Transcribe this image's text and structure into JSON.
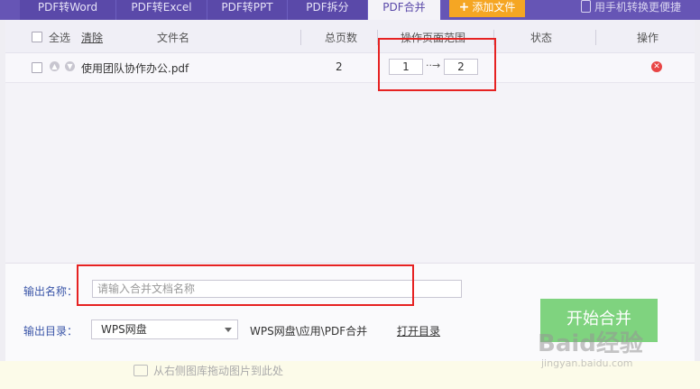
{
  "tabs": [
    {
      "label": "PDF转Word",
      "active": false
    },
    {
      "label": "PDF转Excel",
      "active": false
    },
    {
      "label": "PDF转PPT",
      "active": false
    },
    {
      "label": "PDF拆分",
      "active": false
    },
    {
      "label": "PDF合并",
      "active": true
    }
  ],
  "toolbar": {
    "add_file_label": "添加文件",
    "phone_hint": "用手机转换更便捷"
  },
  "table": {
    "headers": {
      "select_all": "全选",
      "clear": "清除",
      "filename": "文件名",
      "total_pages": "总页数",
      "page_range": "操作页面范围",
      "status": "状态",
      "actions": "操作"
    },
    "rows": [
      {
        "filename": "使用团队协作办公.pdf",
        "total_pages": "2",
        "range_from": "1",
        "range_to": "2",
        "status": ""
      }
    ]
  },
  "output": {
    "name_label": "输出名称：",
    "name_placeholder": "请输入合并文档名称",
    "name_value": "",
    "dir_label": "输出目录：",
    "dir_selected": "WPS网盘",
    "dir_path": "WPS网盘\\应用\\PDF合并",
    "open_dir_label": "打开目录",
    "start_label": "开始合并"
  },
  "lower_hint": "从右侧图库拖动图片到此处",
  "watermark": {
    "text": "Baid经验",
    "sub": "jingyan.baidu.com"
  },
  "colors": {
    "tab_bg": "#5a49a9",
    "accent_orange": "#f5a623",
    "start_green": "#7fd37f",
    "label_blue": "#3a55a8",
    "highlight_red": "#e62222",
    "delete_red": "#e84545"
  }
}
